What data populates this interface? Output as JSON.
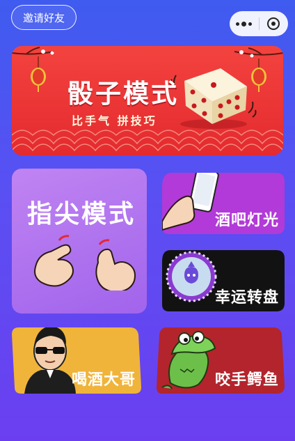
{
  "header": {
    "invite_label": "邀请好友"
  },
  "cards": {
    "dice": {
      "title": "骰子模式",
      "subtitle": "比手气 拼技巧"
    },
    "finger": {
      "title": "指尖模式"
    },
    "bar_light": {
      "label": "酒吧灯光"
    },
    "wheel": {
      "label": "幸运转盘"
    },
    "drink_brother": {
      "label": "喝酒大哥"
    },
    "croc": {
      "label": "咬手鳄鱼"
    }
  },
  "colors": {
    "background_top": "#3f5bf0",
    "background_bottom": "#6b3ff0",
    "dice_card": "#e42a2e",
    "finger_card": "#a164ec",
    "bar_card": "#b13cd8",
    "wheel_card": "#111111",
    "brother_card": "#f0b43a",
    "croc_card": "#b3242c"
  }
}
